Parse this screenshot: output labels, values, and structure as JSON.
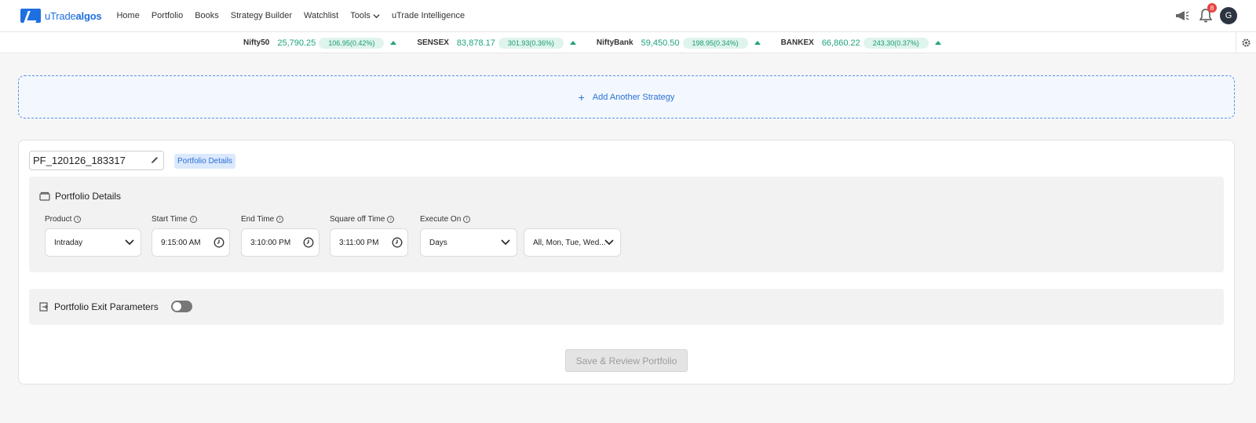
{
  "brand": {
    "name_a": "uTrade",
    "name_b": "algos"
  },
  "nav": {
    "items": [
      {
        "label": "Home"
      },
      {
        "label": "Portfolio"
      },
      {
        "label": "Books"
      },
      {
        "label": "Strategy Builder"
      },
      {
        "label": "Watchlist"
      },
      {
        "label": "Tools"
      },
      {
        "label": "uTrade Intelligence"
      }
    ],
    "notifications_count": "8",
    "avatar_initial": "G"
  },
  "ticker": [
    {
      "name": "Nifty50",
      "value": "25,790.25",
      "change": "106.95(0.42%)"
    },
    {
      "name": "SENSEX",
      "value": "83,878.17",
      "change": "301.93(0.36%)"
    },
    {
      "name": "NiftyBank",
      "value": "59,450.50",
      "change": "198.95(0.34%)"
    },
    {
      "name": "BANKEX",
      "value": "66,860.22",
      "change": "243.30(0.37%)"
    }
  ],
  "add_strategy": {
    "label": "Add Another Strategy"
  },
  "portfolio": {
    "name": "PF_120126_183317",
    "tab_label": "Portfolio Details",
    "details_title": "Portfolio Details",
    "fields": {
      "product": {
        "label": "Product",
        "value": "Intraday"
      },
      "start_time": {
        "label": "Start Time",
        "value": "9:15:00 AM"
      },
      "end_time": {
        "label": "End Time",
        "value": "3:10:00 PM"
      },
      "square_off": {
        "label": "Square off Time",
        "value": "3:11:00 PM"
      },
      "execute_on": {
        "label": "Execute On",
        "value": "Days"
      },
      "days": {
        "value": "All, Mon, Tue, Wed..."
      }
    },
    "exit_title": "Portfolio Exit Parameters",
    "save_label": "Save & Review Portfolio"
  },
  "colors": {
    "accent": "#1e6fe0",
    "positive": "#1fa37e",
    "badge": "#e8423f"
  }
}
